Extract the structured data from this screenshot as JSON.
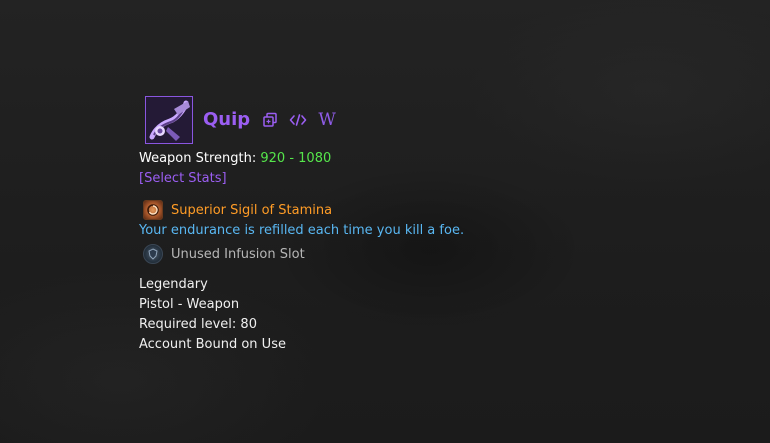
{
  "item": {
    "name": "Quip",
    "icon": "quip-pistol-icon",
    "name_color": "#9b5ef2"
  },
  "actions": {
    "copy": "copy-icon",
    "code": "code-icon",
    "wiki_label": "W"
  },
  "stats": {
    "weapon_strength_label": "Weapon Strength:",
    "weapon_strength_value": "920 - 1080",
    "select_stats_label": "[Select Stats]"
  },
  "upgrade": {
    "sigil_name": "Superior Sigil of Stamina",
    "sigil_description": "Your endurance is refilled each time you kill a foe.",
    "infusion_slot_label": "Unused Infusion Slot"
  },
  "details": {
    "rarity": "Legendary",
    "type": "Pistol - Weapon",
    "required_level": "Required level: 80",
    "binding": "Account Bound on Use"
  },
  "colors": {
    "legendary": "#9b5ef2",
    "weapon_strength": "#55e64b",
    "sigil": "#ff9c26",
    "sigil_description": "#59b7f2",
    "muted": "#b7b7b7"
  }
}
